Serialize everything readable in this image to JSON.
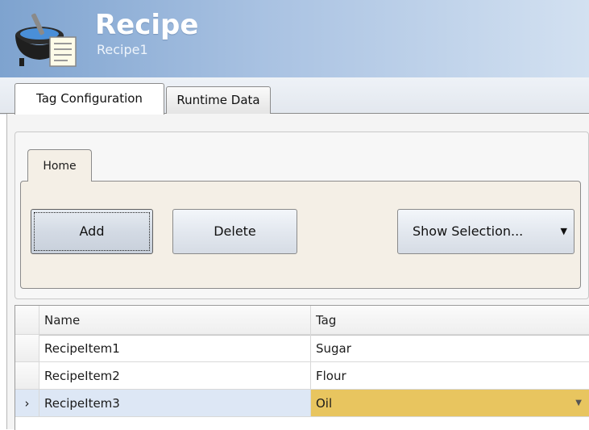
{
  "header": {
    "title": "Recipe",
    "subtitle": "Recipe1",
    "logo_icon": "cooking-pot-recipe-icon"
  },
  "tabs": [
    {
      "label": "Tag Configuration",
      "active": true
    },
    {
      "label": "Runtime Data",
      "active": false
    }
  ],
  "ribbon": {
    "tab_label": "Home",
    "buttons": {
      "add": "Add",
      "delete": "Delete",
      "show_selection": "Show Selection..."
    },
    "dropdown_icon": "caret-down-icon"
  },
  "grid": {
    "columns": [
      "Name",
      "Tag"
    ],
    "rows": [
      {
        "name": "RecipeItem1",
        "tag": "Sugar",
        "selected": false
      },
      {
        "name": "RecipeItem2",
        "tag": "Flour",
        "selected": false
      },
      {
        "name": "RecipeItem3",
        "tag": "Oil",
        "selected": true
      }
    ],
    "current_row_indicator": "›"
  },
  "colors": {
    "header_start": "#7ea3cf",
    "header_end": "#d3e1f1",
    "selected_tag": "#e8c55f",
    "selected_row": "#dde7f5"
  }
}
